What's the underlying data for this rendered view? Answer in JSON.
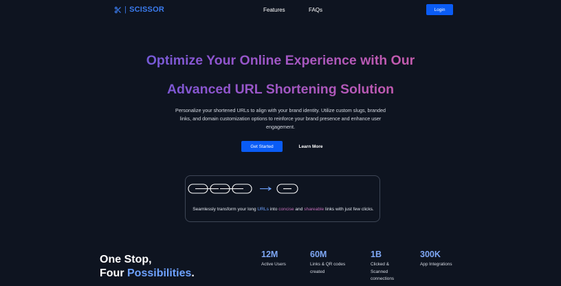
{
  "nav": {
    "logo_text": "SCISSOR",
    "logo_separator": "|",
    "logo_icon": "scissors-icon",
    "links": [
      "Features",
      "FAQs"
    ],
    "login_label": "Login",
    "accent_color": "#0a5cf5"
  },
  "hero": {
    "title_line_1": "Optimize Your Online Experience with Our",
    "title_line_2": "Advanced URL Shortening Solution",
    "description": "Personalize your shortened URLs to align with your brand identity. Utilize custom slugs, branded links, and domain customization options to reinforce your brand presence and enhance user engagement.",
    "primary_cta": "Get Started",
    "secondary_cta": "Learn More",
    "gradient_colors": [
      "#3d66e8",
      "#8e55cf",
      "#c15ab0",
      "#d36a9a"
    ]
  },
  "demo": {
    "icons": [
      "link-chain-icon",
      "arrow-right-icon",
      "short-link-icon"
    ],
    "text_prefix": "Seamlessly transform your long ",
    "keyword_1": "URLs",
    "text_mid_1": " into ",
    "keyword_2": "concise",
    "text_mid_2": " and ",
    "keyword_3": "shareable",
    "text_suffix": " links with just few clicks."
  },
  "features": {
    "title_line_1": "One Stop,",
    "title_line_2_prefix": "Four ",
    "title_line_2_accent": "Possibilities",
    "title_line_2_suffix": "."
  },
  "stats": [
    {
      "value": "12M",
      "label": "Active Users"
    },
    {
      "value": "60M",
      "label": "Links & QR codes created"
    },
    {
      "value": "1B",
      "label": "Clicked & Scanned connections"
    },
    {
      "value": "300K",
      "label": "App Integrations"
    }
  ]
}
